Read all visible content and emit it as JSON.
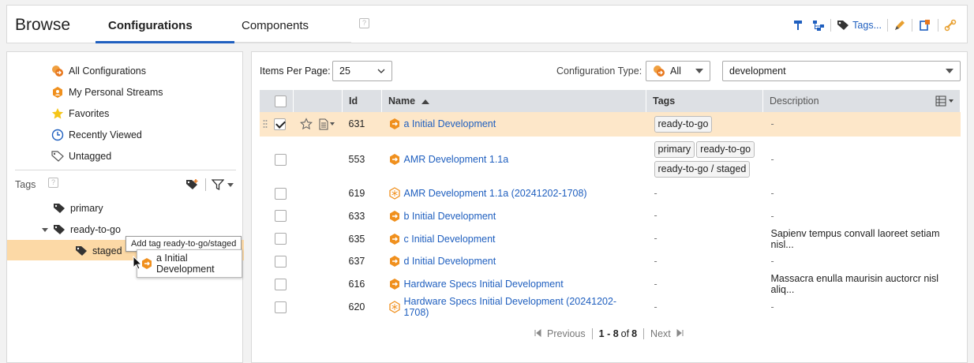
{
  "header": {
    "title": "Browse",
    "tabs": [
      {
        "label": "Configurations",
        "active": true
      },
      {
        "label": "Components",
        "active": false
      }
    ],
    "help": "?",
    "tools": {
      "tags_label": "Tags..."
    }
  },
  "sidebar": {
    "items": [
      {
        "label": "All Configurations",
        "icon": "all-configurations-icon"
      },
      {
        "label": "My Personal Streams",
        "icon": "personal-stream-icon"
      },
      {
        "label": "Favorites",
        "icon": "star-icon"
      },
      {
        "label": "Recently Viewed",
        "icon": "clock-icon"
      },
      {
        "label": "Untagged",
        "icon": "tag-outline-icon"
      }
    ],
    "tags_header": "Tags",
    "tags_help": "?",
    "tags": [
      {
        "label": "primary"
      },
      {
        "label": "ready-to-go"
      },
      {
        "label": "staged"
      }
    ],
    "tooltip": "Add tag ready-to-go/staged",
    "drag_item": "a Initial Development"
  },
  "main": {
    "items_per_page_label": "Items Per Page:",
    "items_per_page_value": "25",
    "config_type_label": "Configuration Type:",
    "config_type_value": "All",
    "stream_filter_value": "development",
    "columns": {
      "id": "Id",
      "name": "Name",
      "tags": "Tags",
      "description": "Description"
    },
    "rows": [
      {
        "id": "631",
        "name": "a Initial Development",
        "tags": [
          "ready-to-go"
        ],
        "description": "-",
        "selected": true,
        "icon": "stream-icon"
      },
      {
        "id": "553",
        "name": "AMR Development 1.1a",
        "tags": [
          "primary",
          "ready-to-go",
          "ready-to-go / staged"
        ],
        "description": "-",
        "selected": false,
        "icon": "stream-icon"
      },
      {
        "id": "619",
        "name": "AMR Development 1.1a (20241202-1708)",
        "tags": [
          "-"
        ],
        "description": "-",
        "selected": false,
        "icon": "baseline-icon"
      },
      {
        "id": "633",
        "name": "b Initial Development",
        "tags": [
          "-"
        ],
        "description": "-",
        "selected": false,
        "icon": "stream-icon"
      },
      {
        "id": "635",
        "name": "c Initial Development",
        "tags": [
          "-"
        ],
        "description": "Sapienv tempus convall laoreet setiam nisl...",
        "selected": false,
        "icon": "stream-icon"
      },
      {
        "id": "637",
        "name": "d Initial Development",
        "tags": [
          "-"
        ],
        "description": "-",
        "selected": false,
        "icon": "stream-icon"
      },
      {
        "id": "616",
        "name": "Hardware Specs Initial Development",
        "tags": [
          "-"
        ],
        "description": "Massacra enulla maurisin auctorcr nisl aliq...",
        "selected": false,
        "icon": "stream-icon"
      },
      {
        "id": "620",
        "name": "Hardware Specs Initial Development (20241202-1708)",
        "tags": [
          "-"
        ],
        "description": "-",
        "selected": false,
        "icon": "baseline-icon"
      }
    ],
    "pager": {
      "previous": "Previous",
      "range": "1 - 8",
      "of": "of",
      "total": "8",
      "next": "Next"
    }
  },
  "colors": {
    "accent": "#1f5fbf",
    "selected_row": "#fde7c9",
    "orange": "#f0901e"
  }
}
